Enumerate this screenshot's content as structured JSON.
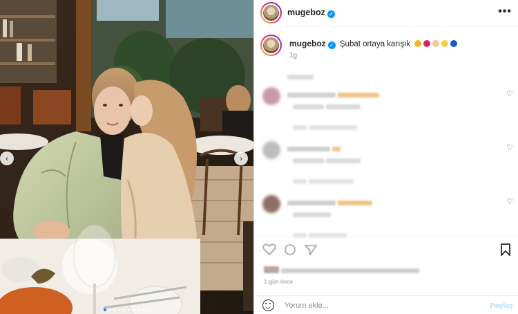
{
  "post": {
    "username": "mugeboz",
    "verified_glyph": "✓",
    "more_glyph": "•••",
    "caption_text": "Şubat ortaya karışık",
    "caption_emojis": [
      "#f4b52a",
      "#e0245e",
      "#f1c9a0",
      "#f6cf40",
      "#1a58c9"
    ],
    "posted_time": "1g",
    "accent_color": "#0095f6"
  },
  "media": {
    "prev_glyph": "‹",
    "next_glyph": "›",
    "carousel_dots": 10,
    "active_dot": 0
  },
  "actions": {
    "icons": [
      "heart-icon",
      "comment-icon",
      "share-icon",
      "bookmark-icon"
    ],
    "date_text": "1 gün önce"
  },
  "comment_box": {
    "emoji_icon": "smiley-icon",
    "placeholder": "Yorum ekle...",
    "share_label": "Paylaş"
  }
}
